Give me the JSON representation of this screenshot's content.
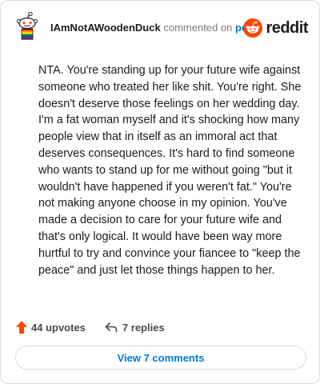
{
  "comment": {
    "username": "IAmNotAWoodenDuck",
    "action_text": "commented on",
    "post_link": "post",
    "brand": "reddit",
    "body": "NTA. You're standing up for your future wife against someone who treated her like shit. You're right. She doesn't deserve those feelings on her wedding day. I'm a fat woman myself and it's shocking how many people view that in itself as an immoral act that deserves consequences. It's hard to find someone who wants to stand up for me without going \"but it wouldn't have happened if you weren't fat.\" You're not making anyone choose in my opinion. You've made a decision to care for your future wife and that's only logical. It would have been way more hurtful to try and convince your fiancee to \"keep the peace\" and just let those things happen to her."
  },
  "actions": {
    "upvotes": "44 upvotes",
    "replies": "7 replies"
  },
  "footer": {
    "view_comments": "View 7 comments"
  },
  "icons": {
    "avatar": "snoo-avatar-icon",
    "brand_logo": "reddit-logo-icon",
    "upvote": "upvote-arrow-icon",
    "reply": "reply-arrow-icon"
  },
  "colors": {
    "brand_orange": "#ff4500",
    "link_blue": "#0079d3",
    "text": "#1c1c1c",
    "muted": "#7c7c7c"
  }
}
